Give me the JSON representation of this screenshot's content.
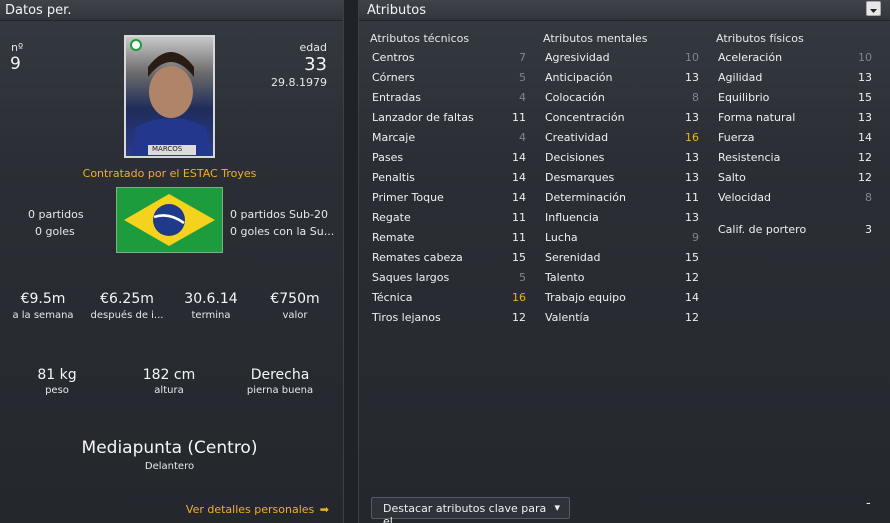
{
  "left": {
    "title": "Datos per.",
    "number_label": "nº",
    "number": "9",
    "age_label": "edad",
    "age": "33",
    "dob": "29.8.1979",
    "photo_caption": "MARCOS",
    "contract": "Contratado por el ESTAC Troyes",
    "stats_left": [
      "0 partidos",
      "0 goles"
    ],
    "stats_right": [
      "0 partidos Sub-20",
      "0 goles con la Su..."
    ],
    "money": [
      {
        "value": "€9.5m",
        "label": "a la semana"
      },
      {
        "value": "€6.25m",
        "label": "después de i..."
      },
      {
        "value": "30.6.14",
        "label": "termina"
      },
      {
        "value": "€750m",
        "label": "valor"
      }
    ],
    "body": [
      {
        "value": "81 kg",
        "label": "peso"
      },
      {
        "value": "182 cm",
        "label": "altura"
      },
      {
        "value": "Derecha",
        "label": "pierna buena"
      }
    ],
    "position": "Mediapunta (Centro)",
    "role": "Delantero",
    "details_link": "Ver detalles personales"
  },
  "right": {
    "title": "Atributos",
    "technical": {
      "title": "Atributos técnicos",
      "items": [
        {
          "label": "Centros",
          "value": "7",
          "style": "dim"
        },
        {
          "label": "Córners",
          "value": "5",
          "style": "dim"
        },
        {
          "label": "Entradas",
          "value": "4",
          "style": "dim"
        },
        {
          "label": "Lanzador de faltas",
          "value": "11",
          "style": ""
        },
        {
          "label": "Marcaje",
          "value": "4",
          "style": "dim"
        },
        {
          "label": "Pases",
          "value": "14",
          "style": ""
        },
        {
          "label": "Penaltis",
          "value": "14",
          "style": ""
        },
        {
          "label": "Primer Toque",
          "value": "14",
          "style": ""
        },
        {
          "label": "Regate",
          "value": "11",
          "style": ""
        },
        {
          "label": "Remate",
          "value": "11",
          "style": ""
        },
        {
          "label": "Remates cabeza",
          "value": "15",
          "style": ""
        },
        {
          "label": "Saques largos",
          "value": "5",
          "style": "dim"
        },
        {
          "label": "Técnica",
          "value": "16",
          "style": "hi"
        },
        {
          "label": "Tiros lejanos",
          "value": "12",
          "style": ""
        }
      ]
    },
    "mental": {
      "title": "Atributos mentales",
      "items": [
        {
          "label": "Agresividad",
          "value": "10",
          "style": "dim"
        },
        {
          "label": "Anticipación",
          "value": "13",
          "style": ""
        },
        {
          "label": "Colocación",
          "value": "8",
          "style": "dim"
        },
        {
          "label": "Concentración",
          "value": "13",
          "style": ""
        },
        {
          "label": "Creatividad",
          "value": "16",
          "style": "hi"
        },
        {
          "label": "Decisiones",
          "value": "13",
          "style": ""
        },
        {
          "label": "Desmarques",
          "value": "13",
          "style": ""
        },
        {
          "label": "Determinación",
          "value": "11",
          "style": ""
        },
        {
          "label": "Influencia",
          "value": "13",
          "style": ""
        },
        {
          "label": "Lucha",
          "value": "9",
          "style": "dim"
        },
        {
          "label": "Serenidad",
          "value": "15",
          "style": ""
        },
        {
          "label": "Talento",
          "value": "12",
          "style": ""
        },
        {
          "label": "Trabajo equipo",
          "value": "14",
          "style": ""
        },
        {
          "label": "Valentía",
          "value": "12",
          "style": ""
        }
      ]
    },
    "physical": {
      "title": "Atributos físicos",
      "items": [
        {
          "label": "Aceleración",
          "value": "10",
          "style": "dim"
        },
        {
          "label": "Agilidad",
          "value": "13",
          "style": ""
        },
        {
          "label": "Equilibrio",
          "value": "15",
          "style": ""
        },
        {
          "label": "Forma natural",
          "value": "13",
          "style": ""
        },
        {
          "label": "Fuerza",
          "value": "14",
          "style": ""
        },
        {
          "label": "Resistencia",
          "value": "12",
          "style": ""
        },
        {
          "label": "Salto",
          "value": "12",
          "style": ""
        },
        {
          "label": "Velocidad",
          "value": "8",
          "style": "dim"
        }
      ],
      "gk_label": "Calif. de portero",
      "gk_value": "3"
    },
    "highlight_dropdown": "Destacar atributos clave para el...",
    "minus": "-"
  }
}
